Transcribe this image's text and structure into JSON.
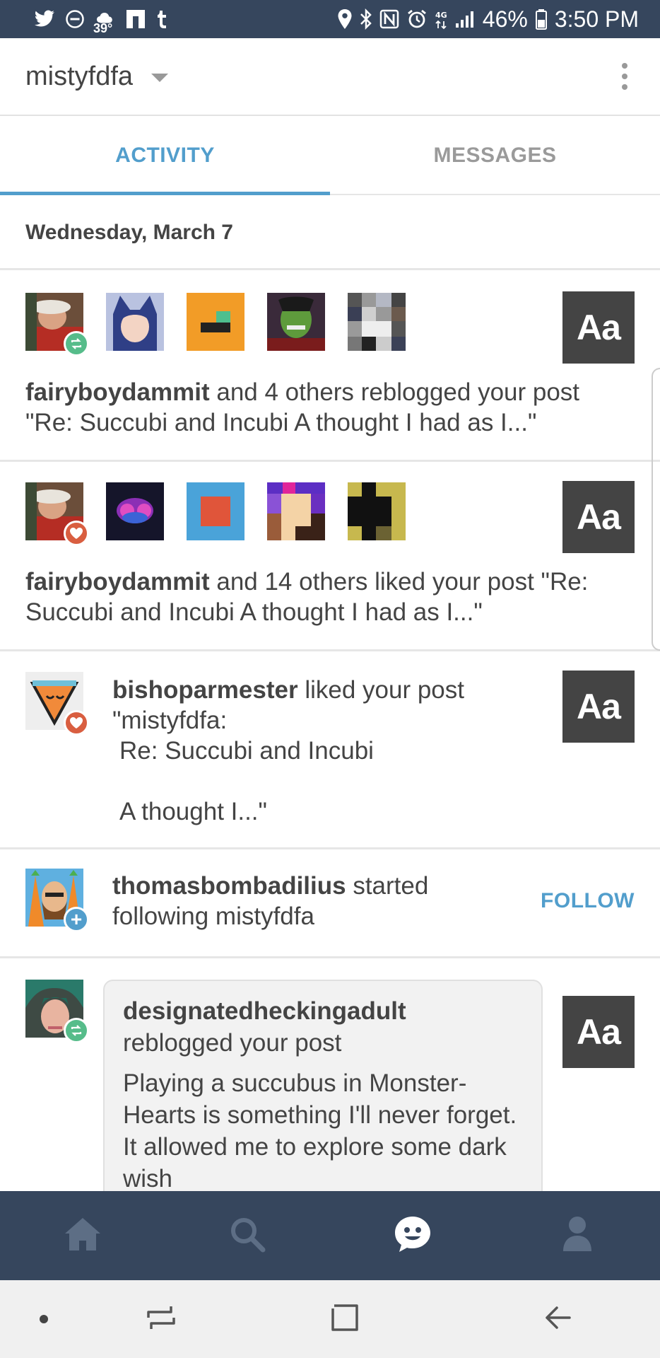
{
  "status_bar": {
    "temperature": "39°",
    "battery": "46%",
    "time": "3:50 PM"
  },
  "header": {
    "blog_name": "mistyfdfa"
  },
  "tabs": [
    {
      "label": "ACTIVITY",
      "active": true
    },
    {
      "label": "MESSAGES",
      "active": false
    }
  ],
  "date_header": "Wednesday, March 7",
  "notifications": [
    {
      "type": "reblog-group",
      "user": "fairyboydammit",
      "text": " and 4 others reblogged your post \"Re: Succubi and Incubi  A thought I had as I...\"",
      "thumb_label": "Aa"
    },
    {
      "type": "like-group",
      "user": "fairyboydammit",
      "text": " and 14 others liked your post \"Re: Succubi and Incubi  A thought I had as I...\"",
      "thumb_label": "Aa"
    },
    {
      "type": "like",
      "user": "bishoparmester",
      "text": " liked your post",
      "quote_lines": [
        "\"mistyfdfa:",
        "Re: Succubi and Incubi",
        "",
        "A thought I...\""
      ],
      "thumb_label": "Aa"
    },
    {
      "type": "follow",
      "user": "thomasbombadilius",
      "text": " started following mistyfdfa",
      "action_label": "FOLLOW"
    },
    {
      "type": "reblog",
      "user": "designatedheckingadult",
      "text": " reblogged your post",
      "excerpt": "Playing a succubus in Monster-Hearts is something I'll never forget. It allowed me to explore some dark wish",
      "thumb_label": "Aa"
    }
  ],
  "bottom_nav": [
    "home-icon",
    "search-icon",
    "activity-icon",
    "account-icon"
  ],
  "colors": {
    "navy": "#36465d",
    "accent_blue": "#529ecc",
    "reblog_green": "#56bc8a",
    "like_red": "#d95e40"
  }
}
